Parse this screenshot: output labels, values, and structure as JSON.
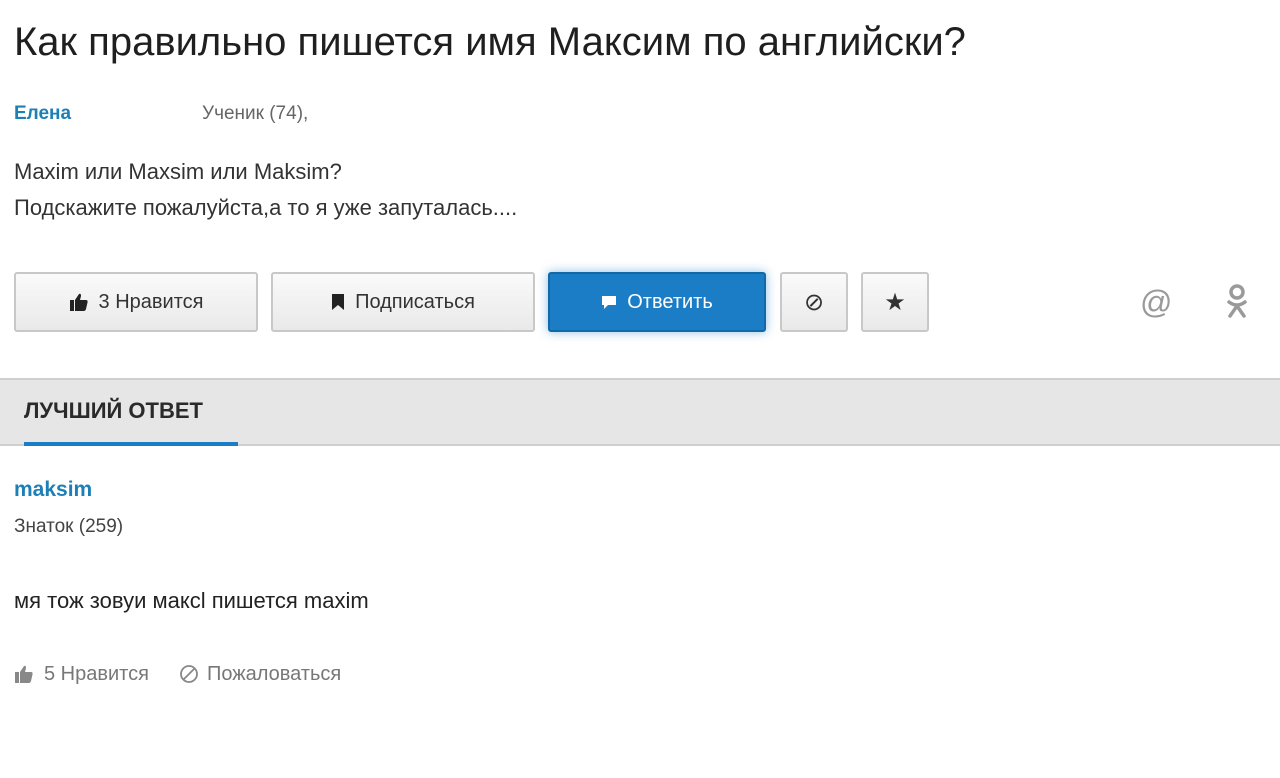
{
  "question": {
    "title": "Как правильно пишется имя Максим по английски?",
    "author": "Елена",
    "author_rank": "Ученик (74),",
    "body_line1": "Maxim или Maxsim или Maksim?",
    "body_line2": "Подскажите пожалуйста,а то я уже запуталась...."
  },
  "actions": {
    "like_label": "3 Нравится",
    "subscribe_label": "Подписаться",
    "answer_label": "Ответить",
    "block_icon": "⊘",
    "star_icon": "★",
    "at_icon": "@",
    "ok_icon": "ok-icon"
  },
  "best_answer": {
    "tab_label": "ЛУЧШИЙ ОТВЕТ",
    "author": "maksim",
    "author_rank": "Знаток (259)",
    "text": "мя тож зовуи максl пишется maxim",
    "like_label": "5 Нравится",
    "report_label": "Пожаловаться"
  },
  "colors": {
    "accent": "#1a7dc6",
    "link": "#1c7fb5"
  }
}
